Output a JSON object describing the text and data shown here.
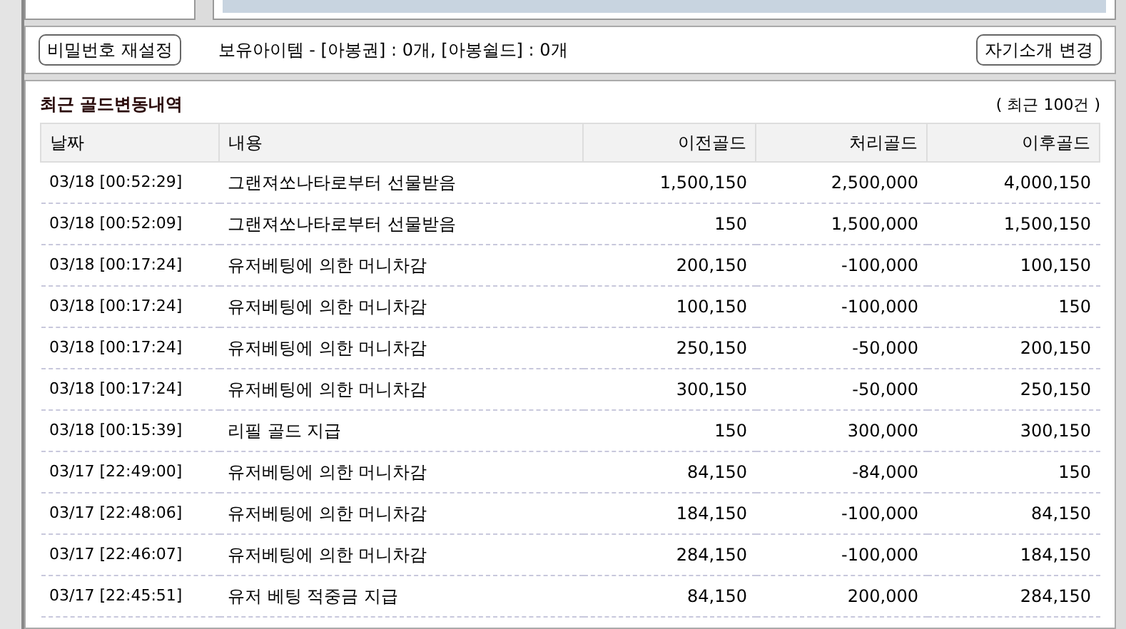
{
  "toolbar": {
    "reset_password_button": "비밀번호 재설정",
    "items_owned": "보유아이템 - [아봉권] : 0개, [아봉쉴드] : 0개",
    "change_intro_button": "자기소개 변경"
  },
  "history": {
    "title": "최근 골드변동내역",
    "count_note": "( 최근 100건 )",
    "columns": [
      "날짜",
      "내용",
      "이전골드",
      "처리골드",
      "이후골드"
    ],
    "rows": [
      [
        "03/18 [00:52:29]",
        "그랜져쏘나타로부터 선물받음",
        "1,500,150",
        "2,500,000",
        "4,000,150"
      ],
      [
        "03/18 [00:52:09]",
        "그랜져쏘나타로부터 선물받음",
        "150",
        "1,500,000",
        "1,500,150"
      ],
      [
        "03/18 [00:17:24]",
        "유저베팅에 의한 머니차감",
        "200,150",
        "-100,000",
        "100,150"
      ],
      [
        "03/18 [00:17:24]",
        "유저베팅에 의한 머니차감",
        "100,150",
        "-100,000",
        "150"
      ],
      [
        "03/18 [00:17:24]",
        "유저베팅에 의한 머니차감",
        "250,150",
        "-50,000",
        "200,150"
      ],
      [
        "03/18 [00:17:24]",
        "유저베팅에 의한 머니차감",
        "300,150",
        "-50,000",
        "250,150"
      ],
      [
        "03/18 [00:15:39]",
        "리필 골드 지급",
        "150",
        "300,000",
        "300,150"
      ],
      [
        "03/17 [22:49:00]",
        "유저베팅에 의한 머니차감",
        "84,150",
        "-84,000",
        "150"
      ],
      [
        "03/17 [22:48:06]",
        "유저베팅에 의한 머니차감",
        "184,150",
        "-100,000",
        "84,150"
      ],
      [
        "03/17 [22:46:07]",
        "유저베팅에 의한 머니차감",
        "284,150",
        "-100,000",
        "184,150"
      ],
      [
        "03/17 [22:45:51]",
        "유저 베팅 적중금 지급",
        "84,150",
        "200,000",
        "284,150"
      ]
    ]
  }
}
